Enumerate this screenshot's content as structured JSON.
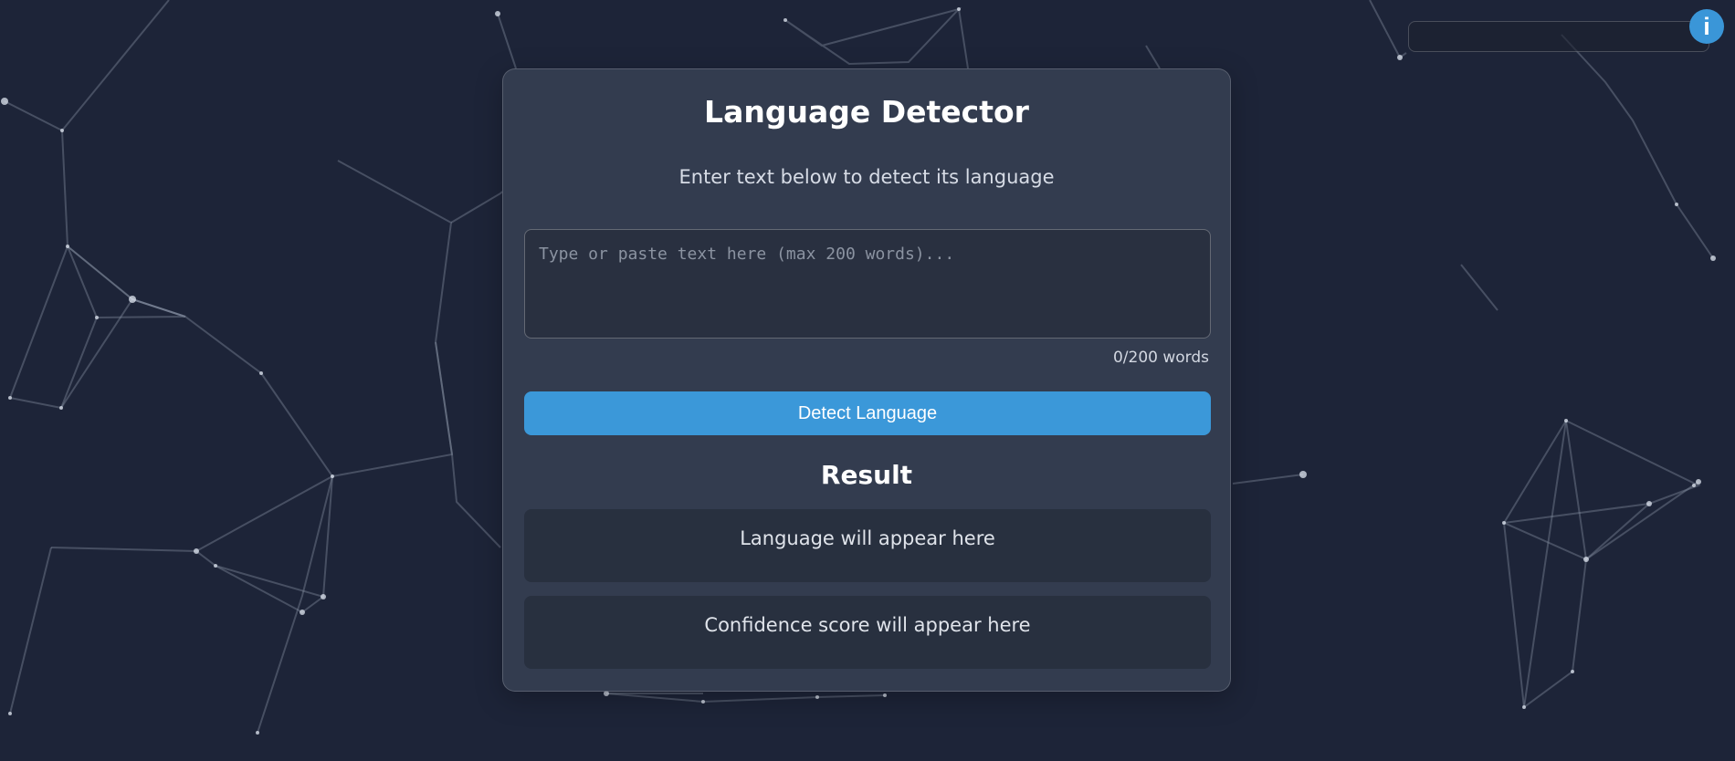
{
  "title": "Language Detector",
  "subtitle": "Enter text below to detect its language",
  "input": {
    "value": "",
    "placeholder": "Type or paste text here (max 200 words)..."
  },
  "word_count": "0/200 words",
  "detect_button": "Detect Language",
  "result": {
    "title": "Result",
    "language_placeholder": "Language will appear here",
    "confidence_placeholder": "Confidence score will appear here"
  },
  "info_button": "i",
  "colors": {
    "background": "#1d2438",
    "card": "#3a4256",
    "accent": "#3b98d9",
    "text": "#ffffff",
    "network": "#8b95a8"
  },
  "icons": {
    "info": "info-icon"
  }
}
